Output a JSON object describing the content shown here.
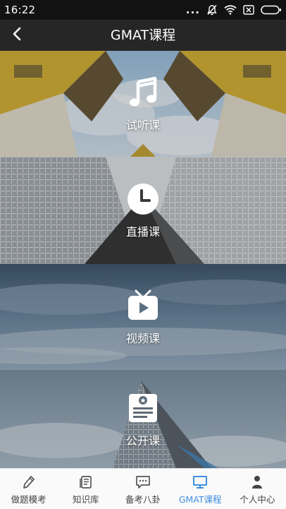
{
  "status_bar": {
    "time": "16:22",
    "more": "..."
  },
  "nav": {
    "title": "GMAT课程"
  },
  "sections": [
    {
      "label": "试听课",
      "icon": "music-note-icon"
    },
    {
      "label": "直播课",
      "icon": "clock-icon"
    },
    {
      "label": "视频课",
      "icon": "tv-play-icon"
    },
    {
      "label": "公开课",
      "icon": "certificate-icon"
    }
  ],
  "tabs": [
    {
      "label": "做题模考",
      "icon": "pencil-icon",
      "active": false
    },
    {
      "label": "知识库",
      "icon": "book-icon",
      "active": false
    },
    {
      "label": "备考八卦",
      "icon": "chat-bubble-icon",
      "active": false
    },
    {
      "label": "GMAT课程",
      "icon": "monitor-icon",
      "active": true
    },
    {
      "label": "个人中心",
      "icon": "person-icon",
      "active": false
    }
  ],
  "colors": {
    "accent": "#3d8fe0",
    "nav_bg": "#262626",
    "status_bg": "#121212"
  }
}
